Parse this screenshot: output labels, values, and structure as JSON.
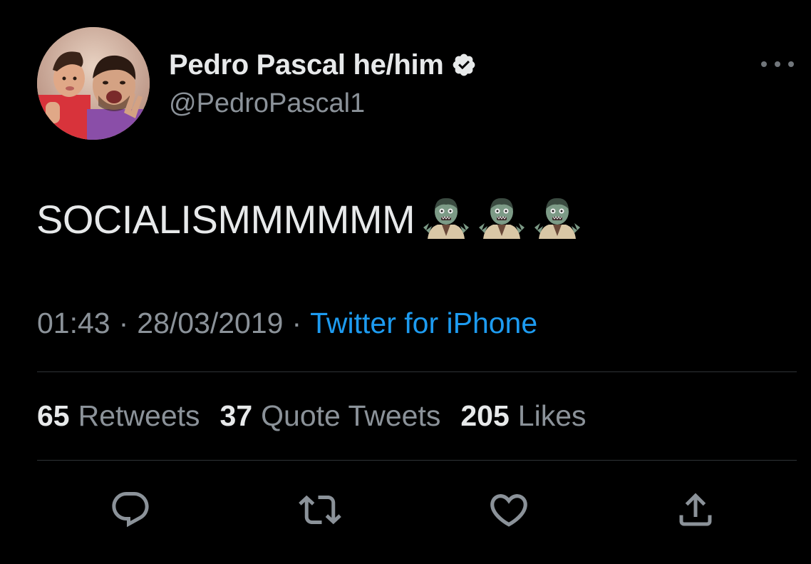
{
  "author": {
    "display_name": "Pedro Pascal he/him",
    "handle": "@PedroPascal1",
    "verified": true
  },
  "tweet": {
    "text": "SOCIALISMMMMMM",
    "emoji": [
      "zombie-icon",
      "zombie-icon",
      "zombie-icon"
    ]
  },
  "meta": {
    "time": "01:43",
    "separator": "·",
    "date": "28/03/2019",
    "source": "Twitter for iPhone"
  },
  "stats": {
    "retweets": {
      "count": "65",
      "label": "Retweets"
    },
    "quotes": {
      "count": "37",
      "label": "Quote Tweets"
    },
    "likes": {
      "count": "205",
      "label": "Likes"
    }
  },
  "actions": [
    "reply-icon",
    "retweet-icon",
    "like-icon",
    "share-icon"
  ],
  "colors": {
    "background": "#000000",
    "text_primary": "#e7e9ea",
    "text_secondary": "#8b9299",
    "link": "#1d9bf0",
    "divider": "#2f3336",
    "icon": "#8b9299"
  }
}
